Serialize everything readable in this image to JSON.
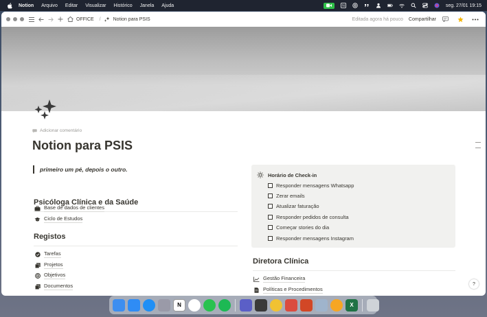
{
  "menubar": {
    "app_name": "Notion",
    "menus": [
      "Arquivo",
      "Editar",
      "Visualizar",
      "Histórico",
      "Janela",
      "Ajuda"
    ],
    "datetime": "seg. 27/01  19:15"
  },
  "topbar": {
    "breadcrumbs": [
      "OFFICE",
      "Notion para PSIS"
    ],
    "separator": "/",
    "edited": "Editada agora há pouco",
    "share": "Compartilhar"
  },
  "page": {
    "add_comment": "Adicionar comentário",
    "title": "Notion para PSIS",
    "quote": "primeiro um pé, depois o outro."
  },
  "sections": {
    "psico": {
      "heading": "Psicóloga Clínica e da Saúde",
      "links": [
        "Base de dados de clientes",
        "Ciclo de Estudos"
      ]
    },
    "registos": {
      "heading": "Registos",
      "links": [
        "Tarefas",
        "Projetos",
        "Objetivos",
        "Documentos"
      ]
    },
    "diretora": {
      "heading": "Diretora Clínica",
      "links": [
        "Gestão Financeira",
        "Políticas e Procedimentos"
      ]
    }
  },
  "callout": {
    "title": "Horário de Check-in",
    "todos": [
      "Responder mensagens Whatsapp",
      "Zerar emails",
      "Atualizar faturação",
      "Responder pedidos de consulta",
      "Começar stories do dia",
      "Responder mensagens Instagram"
    ]
  },
  "help": "?",
  "dock": {
    "apps": [
      {
        "name": "finder",
        "color": "#3d8ef0",
        "glyph": ""
      },
      {
        "name": "mail",
        "color": "#2f8cf5",
        "glyph": ""
      },
      {
        "name": "safari",
        "color": "#1f8ff5",
        "glyph": ""
      },
      {
        "name": "launchpad",
        "color": "#9a9aa8",
        "glyph": ""
      },
      {
        "name": "notion",
        "color": "#ffffff",
        "glyph": "N"
      },
      {
        "name": "chatgpt",
        "color": "#ffffff",
        "glyph": ""
      },
      {
        "name": "whatsapp",
        "color": "#29c24f",
        "glyph": ""
      },
      {
        "name": "spotify",
        "color": "#1db954",
        "glyph": ""
      },
      {
        "name": "teams",
        "color": "#5b5fc7",
        "glyph": ""
      },
      {
        "name": "calculator",
        "color": "#3a3a3a",
        "glyph": ""
      },
      {
        "name": "chrome",
        "color": "#f1c232",
        "glyph": ""
      },
      {
        "name": "todoist",
        "color": "#db4c3f",
        "glyph": ""
      },
      {
        "name": "powerpoint",
        "color": "#d24726",
        "glyph": ""
      },
      {
        "name": "preview",
        "color": "#9fb4cc",
        "glyph": ""
      },
      {
        "name": "photos",
        "color": "#f6a623",
        "glyph": ""
      },
      {
        "name": "excel",
        "color": "#1f7244",
        "glyph": "X"
      },
      {
        "name": "trash",
        "color": "#cfd3d8",
        "glyph": ""
      }
    ]
  }
}
